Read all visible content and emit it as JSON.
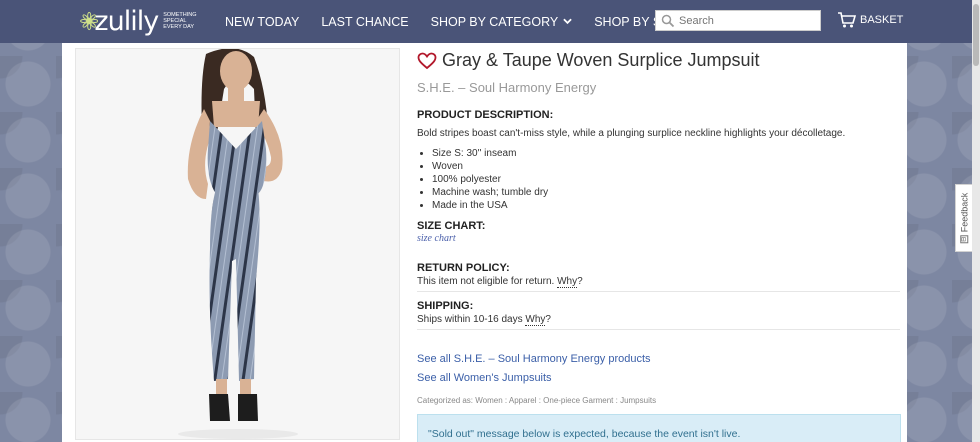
{
  "header": {
    "logo_text": "zulily",
    "logo_tagline": "SOMETHING SPECIAL EVERY DAY",
    "nav": [
      {
        "label": "NEW TODAY"
      },
      {
        "label": "LAST CHANCE"
      },
      {
        "label": "SHOP BY CATEGORY"
      },
      {
        "label": "SHOP BY SIZE"
      }
    ],
    "search_placeholder": "Search",
    "basket_label": "BASKET"
  },
  "product": {
    "title": "Gray & Taupe Woven Surplice Jumpsuit",
    "brand": "S.H.E. – Soul Harmony Energy",
    "description_heading": "PRODUCT DESCRIPTION:",
    "description": "Bold stripes boast can't-miss style, while a plunging surplice neckline highlights your décolletage.",
    "details": [
      "Size S: 30'' inseam",
      "Woven",
      "100% polyester",
      "Machine wash; tumble dry",
      "Made in the USA"
    ],
    "size_chart_heading": "SIZE CHART:",
    "size_chart_link": "size chart",
    "return_heading": "RETURN POLICY:",
    "return_text": "This item not eligible for return.",
    "why_label": "Why",
    "why_suffix": "?",
    "shipping_heading": "SHIPPING:",
    "shipping_text": "Ships within 10-16 days",
    "see_all_brand": "See all S.H.E. – Soul Harmony Energy products",
    "see_all_category": "See all Women's Jumpsuits",
    "categorized": "Categorized as: Women : Apparel : One-piece Garment : Jumpsuits",
    "notice": "\"Sold out\" message below is expected, because the event isn't live."
  },
  "feedback_label": "Feedback",
  "colors": {
    "header_bg": "#4a5478",
    "page_bg": "#7d87a2",
    "link": "#3b5fa8",
    "notice_bg": "#d9edf7",
    "heart": "#b2182b"
  }
}
